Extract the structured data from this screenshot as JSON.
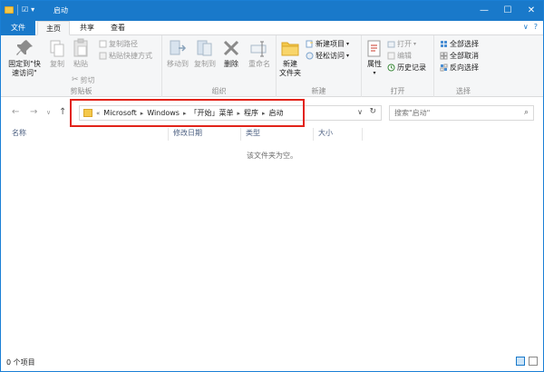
{
  "window": {
    "title": "启动",
    "controls": {
      "minimize": "—",
      "maximize": "☐",
      "close": "✕"
    }
  },
  "quick_access": {
    "glyph1": "☑",
    "glyph2": "▾"
  },
  "tabs": {
    "file": "文件",
    "home": "主页",
    "share": "共享",
    "view": "查看"
  },
  "ribbon_right": {
    "collapse": "∨",
    "help": "?"
  },
  "ribbon": {
    "clipboard": {
      "title": "剪贴板",
      "pin": "固定到\"快\n速访问\"",
      "copy": "复制",
      "paste": "粘贴",
      "copy_path": "复制路径",
      "paste_shortcut": "粘贴快捷方式",
      "cut": "剪切"
    },
    "organize": {
      "title": "组织",
      "move_to": "移动到",
      "copy_to": "复制到",
      "delete": "删除",
      "rename": "重命名"
    },
    "new": {
      "title": "新建",
      "new_folder": "新建\n文件夹",
      "new_item": "新建项目",
      "easy_access": "轻松访问"
    },
    "open": {
      "title": "打开",
      "properties": "属性",
      "open": "打开",
      "edit": "编辑",
      "history": "历史记录"
    },
    "select": {
      "title": "选择",
      "select_all": "全部选择",
      "select_none": "全部取消",
      "invert": "反向选择"
    }
  },
  "nav": {
    "back": "←",
    "forward": "→",
    "dropdown": "∨",
    "up": "↑"
  },
  "address": {
    "prefix": "«",
    "crumbs": [
      "Microsoft",
      "Windows",
      "「开始」菜单",
      "程序",
      "启动"
    ],
    "chevron": "▸",
    "dropdown": "∨",
    "refresh": "↻"
  },
  "search": {
    "placeholder": "搜索\"启动\"",
    "icon": "⌕"
  },
  "columns": {
    "name": "名称",
    "modified": "修改日期",
    "type": "类型",
    "size": "大小"
  },
  "empty_message": "该文件夹为空。",
  "status": {
    "count": "0 个项目"
  },
  "colors": {
    "accent": "#1979ca",
    "highlight": "#e2231a",
    "folder": "#f4c84a"
  }
}
